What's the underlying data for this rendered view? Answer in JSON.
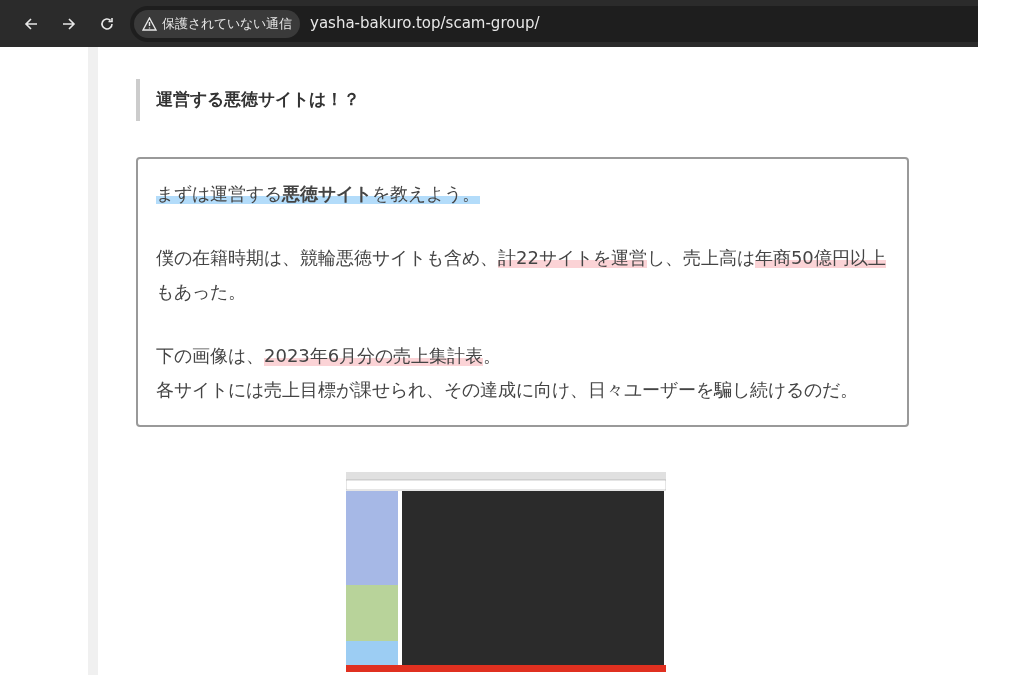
{
  "browser": {
    "security_chip": "保護されていない通信",
    "url": "yasha-bakuro.top/scam-group/"
  },
  "heading": "運営する悪徳サイトは！？",
  "callout": {
    "paragraphs": [
      [
        {
          "text": "まずは運営する**悪徳サイト**を教えよう。",
          "color": "#b3dcfa"
        }
      ],
      [
        {
          "text": "僕の在籍時期は、競輪悪徳サイトも含め、"
        },
        {
          "text": "計22サイトを運営",
          "color": "#fbd3d6"
        },
        {
          "text": "し、売上高は"
        },
        {
          "text": "年商50億円以上",
          "color": "#fbd3d6"
        },
        {
          "text": "もあった。"
        }
      ],
      [
        {
          "text": "下の画像は、"
        },
        {
          "text": "2023年6月分の売上集計表",
          "color": "#fbd3d6"
        },
        {
          "text": "。"
        }
      ],
      [
        {
          "text": "各サイトには売上目標が課せられ、その達成に向け、日々ユーザーを騙し続けるのだ。"
        }
      ]
    ]
  }
}
